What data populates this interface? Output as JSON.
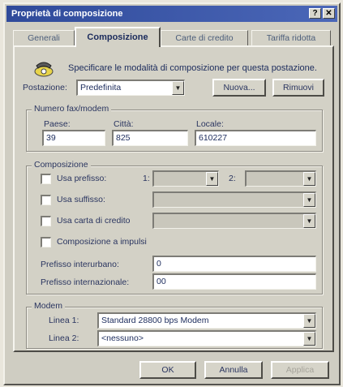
{
  "window": {
    "title": "Proprietà di composizione",
    "help_btn": "?",
    "close_btn": "✕"
  },
  "tabs": [
    {
      "label": "Generali",
      "active": false
    },
    {
      "label": "Composizione",
      "active": true
    },
    {
      "label": "Carte di credito",
      "active": false
    },
    {
      "label": "Tariffa ridotta",
      "active": false
    }
  ],
  "header": {
    "icon": "phone-dial-icon",
    "description": "Specificare le modalità di composizione per questa postazione."
  },
  "location": {
    "label": "Postazione:",
    "value": "Predefinita",
    "new_button": "Nuova...",
    "remove_button": "Rimuovi"
  },
  "phone_number": {
    "group_title": "Numero fax/modem",
    "country_label": "Paese:",
    "country_value": "39",
    "city_label": "Città:",
    "city_value": "825",
    "local_label": "Locale:",
    "local_value": "610227"
  },
  "dialing": {
    "group_title": "Composizione",
    "prefix_label": "Usa prefisso:",
    "prefix_1_label": "1:",
    "prefix_2_label": "2:",
    "suffix_label": "Usa suffisso:",
    "credit_card_label": "Usa carta di credito",
    "pulse_label": "Composizione a impulsi",
    "intercity_label": "Prefisso interurbano:",
    "intercity_value": "0",
    "international_label": "Prefisso internazionale:",
    "international_value": "00"
  },
  "modem": {
    "group_title": "Modem",
    "line1_label": "Linea 1:",
    "line1_value": "Standard 28800 bps Modem",
    "line2_label": "Linea 2:",
    "line2_value": "<nessuno>"
  },
  "footer": {
    "ok": "OK",
    "cancel": "Annulla",
    "apply": "Applica"
  },
  "colors": {
    "titlebar": "#2f4a9a",
    "dialog_bg": "#d3d1c6",
    "label_text": "#2a3560"
  }
}
